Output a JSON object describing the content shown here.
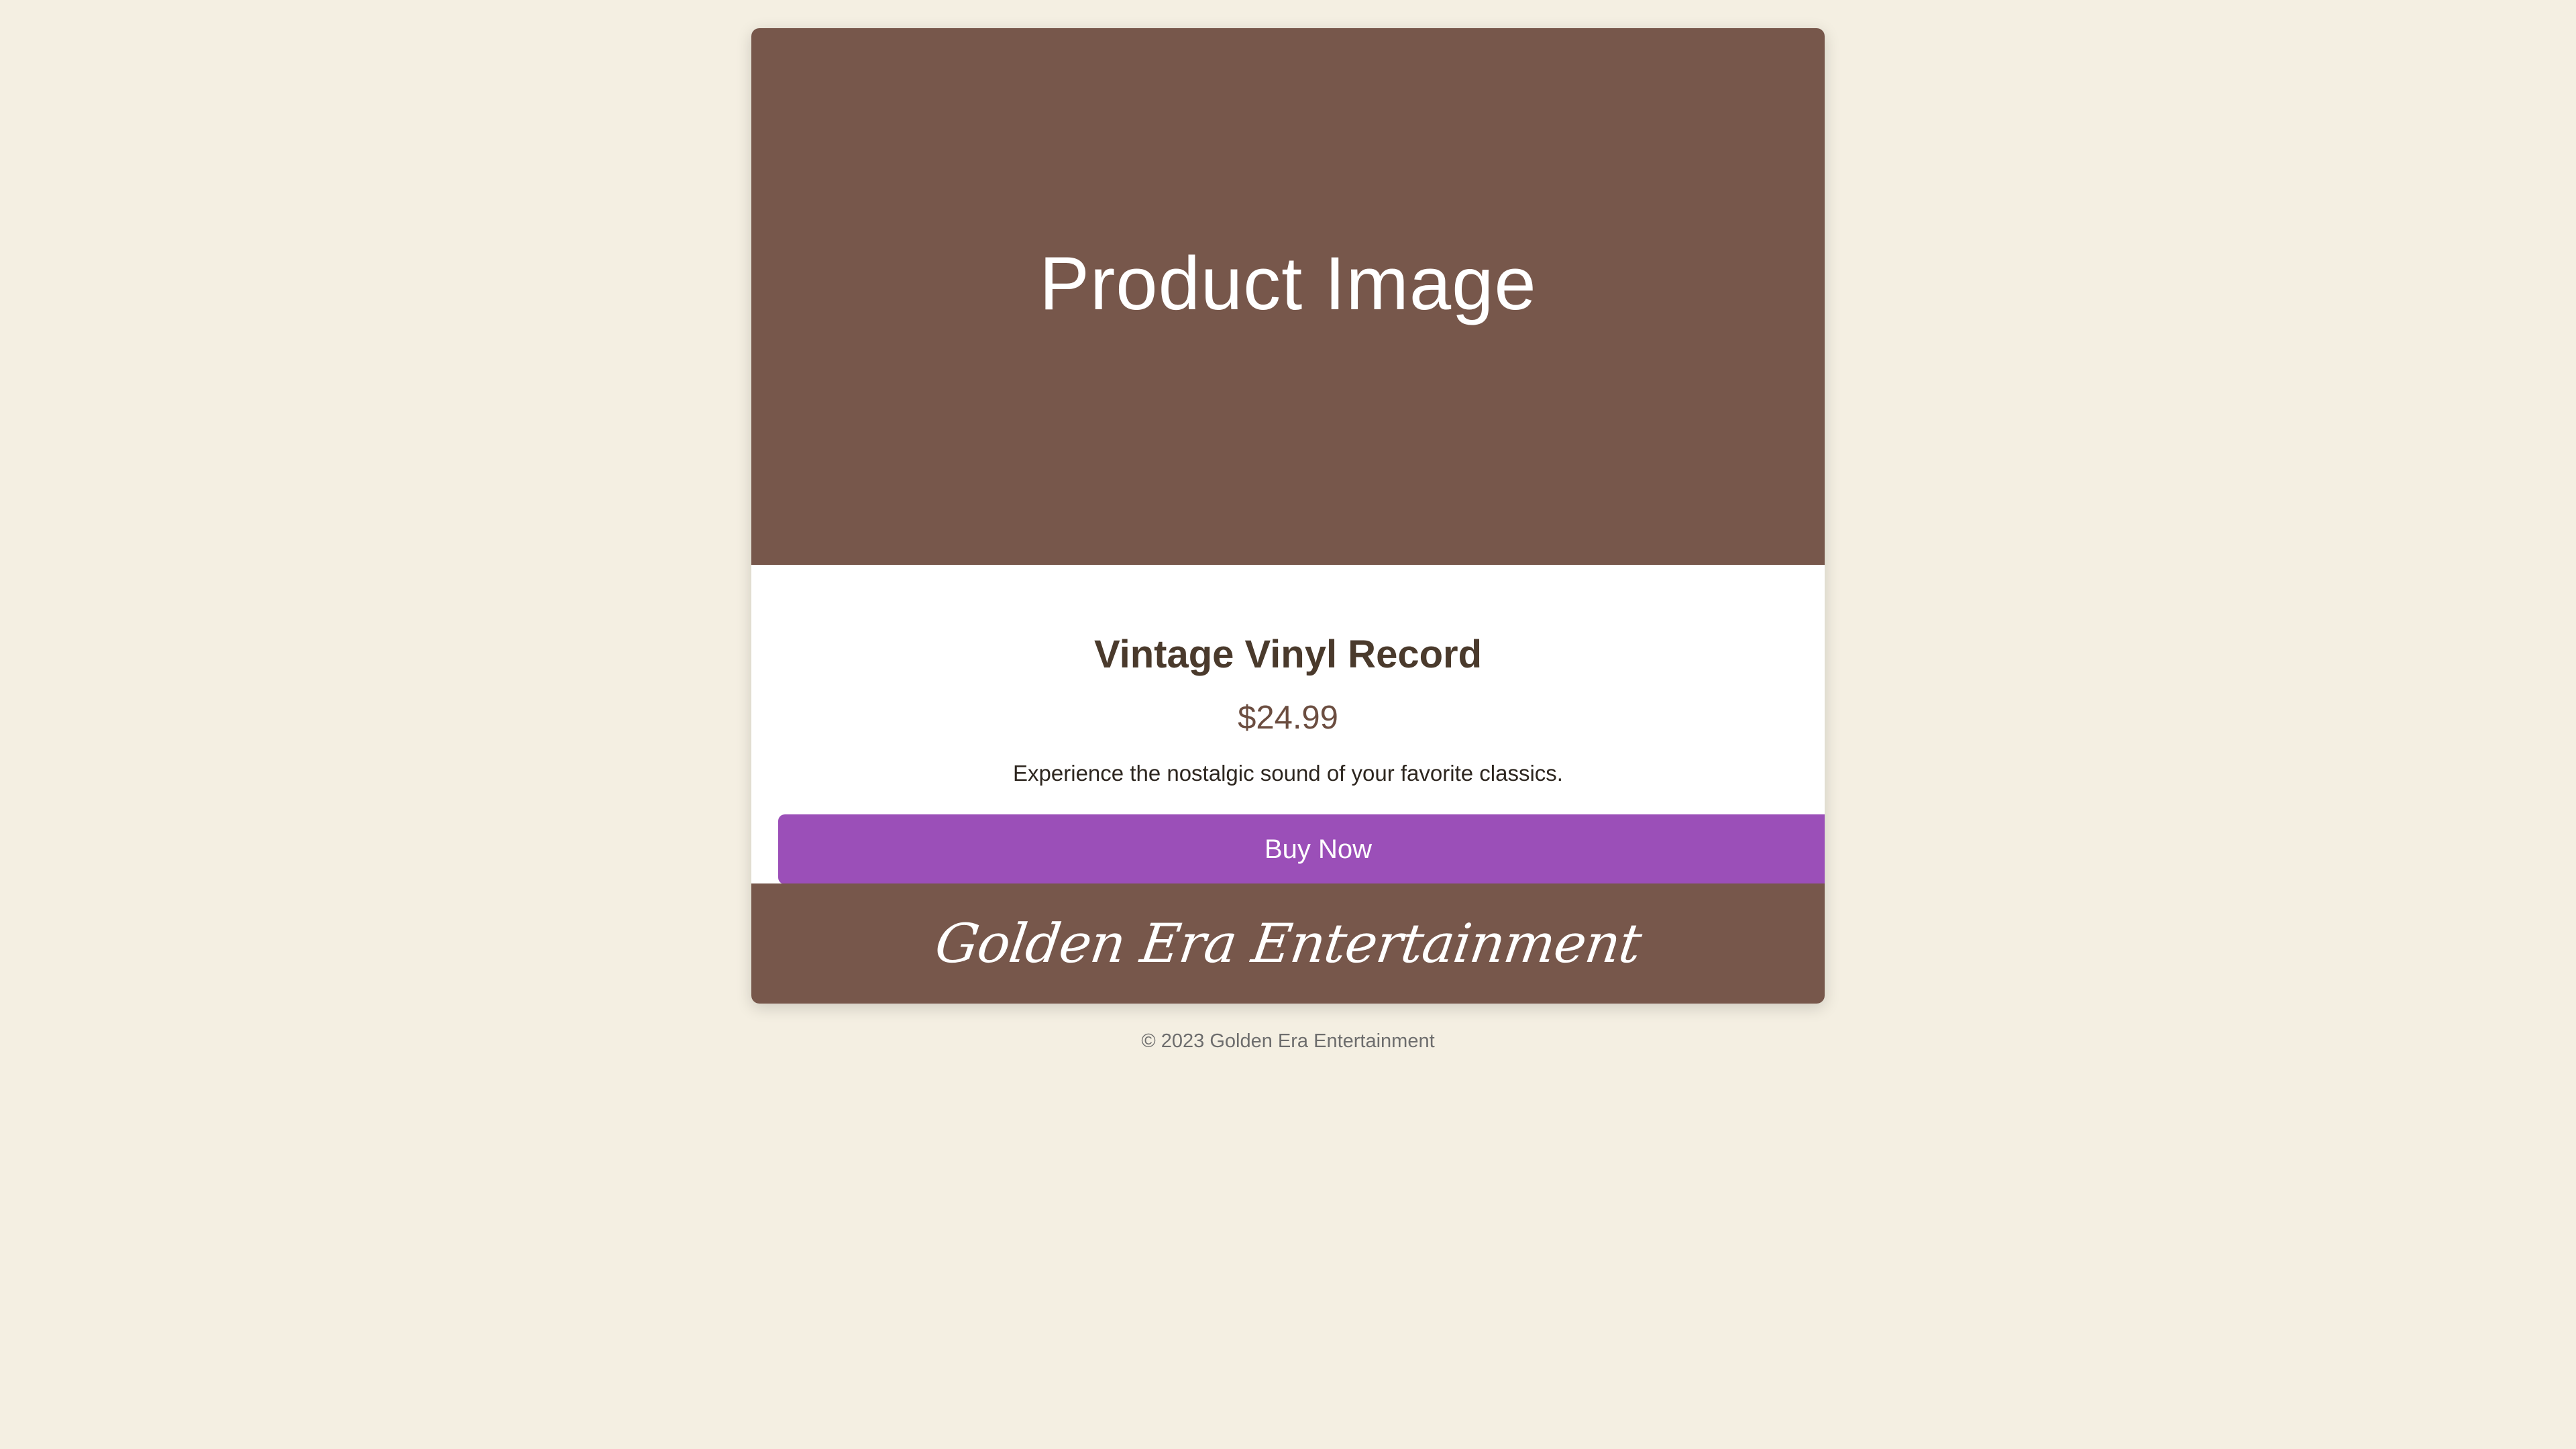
{
  "product": {
    "image_label": "Product Image",
    "title": "Vintage Vinyl Record",
    "price": "$24.99",
    "description": "Experience the nostalgic sound of your favorite classics.",
    "buy_label": "Buy Now"
  },
  "brand": {
    "name": "Golden Era Entertainment"
  },
  "footer": {
    "copyright": "© 2023 Golden Era Entertainment"
  },
  "colors": {
    "page_background": "#f4efe2",
    "brand_brown": "#77574b",
    "button_purple": "#9b4fb8",
    "title_text": "#4a3a2c"
  }
}
